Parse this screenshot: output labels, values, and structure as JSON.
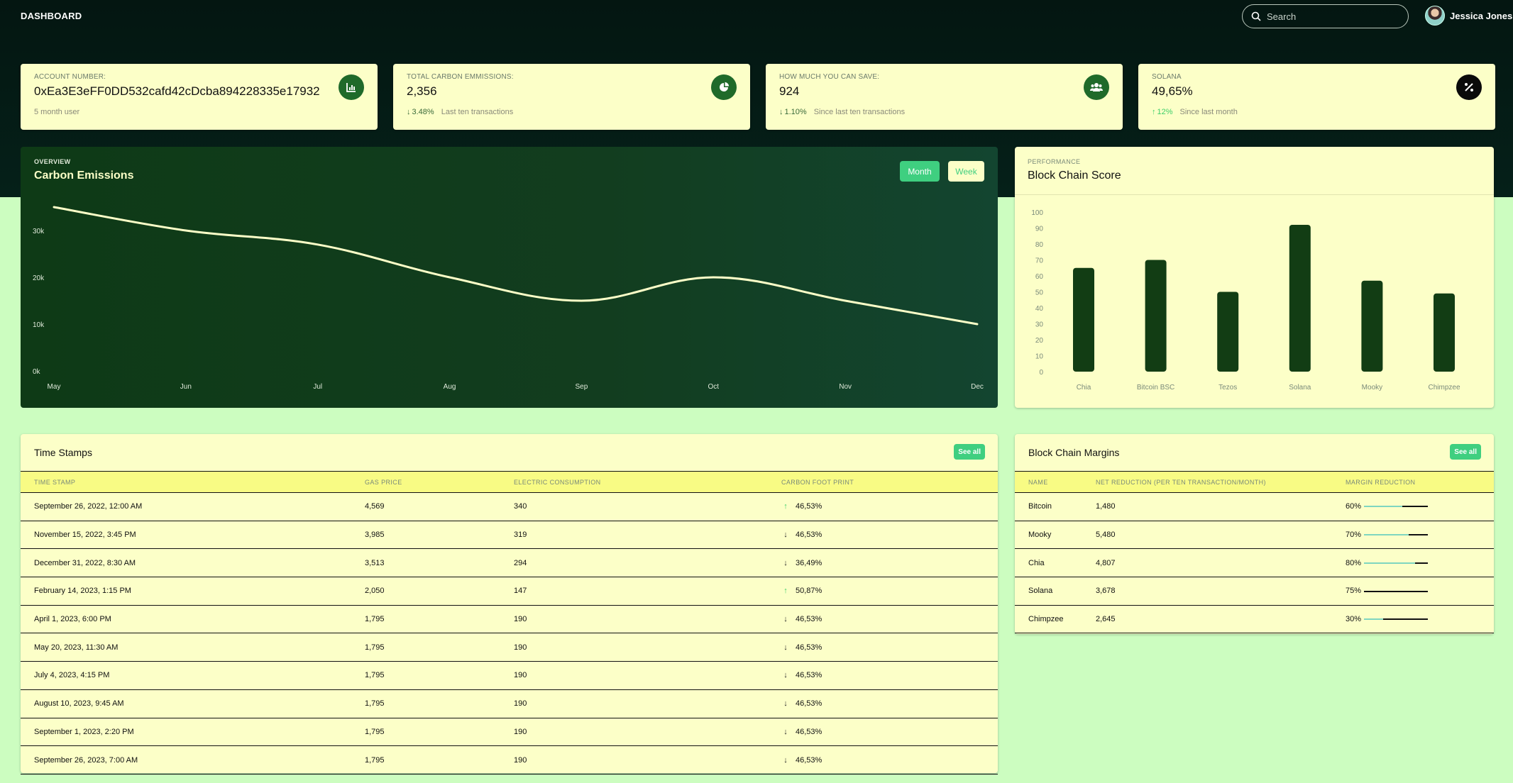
{
  "header": {
    "brand": "DASHBOARD",
    "search_placeholder": "Search",
    "user_name": "Jessica Jones"
  },
  "stats": [
    {
      "label": "ACCOUNT NUMBER:",
      "value": "0xEa3E3eFF0DD532cafd42cDcba894228335e17932",
      "change": "",
      "direction": "",
      "foot": "5 month user",
      "icon": "bar-chart-icon"
    },
    {
      "label": "TOTAL CARBON EMMISSIONS:",
      "value": "2,356",
      "change": "3.48%",
      "direction": "down",
      "foot": "Last ten transactions",
      "icon": "pie-chart-icon"
    },
    {
      "label": "HOW MUCH YOU CAN SAVE:",
      "value": "924",
      "change": "1.10%",
      "direction": "down",
      "foot": "Since last ten transactions",
      "icon": "users-icon"
    },
    {
      "label": "SOLANA",
      "value": "49,65%",
      "change": "12%",
      "direction": "up",
      "foot": "Since last month",
      "icon": "percent-icon"
    }
  ],
  "overview": {
    "kicker": "OVERVIEW",
    "title": "Carbon Emissions",
    "btn_month": "Month",
    "btn_week": "Week"
  },
  "performance": {
    "kicker": "PERFORMANCE",
    "title": "Block Chain Score"
  },
  "chart_data": [
    {
      "type": "line",
      "title": "Carbon Emissions",
      "x": [
        "May",
        "Jun",
        "Jul",
        "Aug",
        "Sep",
        "Oct",
        "Nov",
        "Dec"
      ],
      "values": [
        35000,
        30000,
        27000,
        20000,
        15000,
        20000,
        15000,
        10000
      ],
      "y_ticks": [
        "0k",
        "10k",
        "20k",
        "30k"
      ],
      "ylim": [
        0,
        40000
      ],
      "color": "#fcffc8",
      "grid": false,
      "smooth": true
    },
    {
      "type": "bar",
      "title": "Block Chain Score",
      "categories": [
        "Chia",
        "Bitcoin BSC",
        "Tezos",
        "Solana",
        "Mooky",
        "Chimpzee"
      ],
      "values": [
        65,
        70,
        50,
        92,
        57,
        49
      ],
      "y_ticks": [
        0,
        10,
        20,
        30,
        40,
        50,
        60,
        70,
        80,
        90,
        100
      ],
      "ylim": [
        0,
        100
      ],
      "color": "#123d14",
      "grid": false
    }
  ],
  "timestamps": {
    "title": "Time Stamps",
    "see_all": "See all",
    "columns": [
      "TIME STAMP",
      "GAS PRICE",
      "ELECTRIC CONSUMPTION",
      "CARBON FOOT PRINT"
    ],
    "rows": [
      {
        "time": "September 26, 2022, 12:00 AM",
        "gas": "4,569",
        "electric": "340",
        "dir": "up",
        "carbon": "46,53%"
      },
      {
        "time": "November 15, 2022, 3:45 PM",
        "gas": "3,985",
        "electric": "319",
        "dir": "down",
        "carbon": "46,53%"
      },
      {
        "time": "December 31, 2022, 8:30 AM",
        "gas": "3,513",
        "electric": "294",
        "dir": "down",
        "carbon": "36,49%"
      },
      {
        "time": "February 14, 2023, 1:15 PM",
        "gas": "2,050",
        "electric": "147",
        "dir": "up",
        "carbon": "50,87%"
      },
      {
        "time": "April 1, 2023, 6:00 PM",
        "gas": "1,795",
        "electric": "190",
        "dir": "down",
        "carbon": "46,53%"
      },
      {
        "time": "May 20, 2023, 11:30 AM",
        "gas": "1,795",
        "electric": "190",
        "dir": "down",
        "carbon": "46,53%"
      },
      {
        "time": "July 4, 2023, 4:15 PM",
        "gas": "1,795",
        "electric": "190",
        "dir": "down",
        "carbon": "46,53%"
      },
      {
        "time": "August 10, 2023, 9:45 AM",
        "gas": "1,795",
        "electric": "190",
        "dir": "down",
        "carbon": "46,53%"
      },
      {
        "time": "September 1, 2023, 2:20 PM",
        "gas": "1,795",
        "electric": "190",
        "dir": "down",
        "carbon": "46,53%"
      },
      {
        "time": "September 26, 2023, 7:00 AM",
        "gas": "1,795",
        "electric": "190",
        "dir": "down",
        "carbon": "46,53%"
      }
    ]
  },
  "margins": {
    "title": "Block Chain Margins",
    "see_all": "See all",
    "columns": [
      "NAME",
      "NET REDUCTION (PER TEN TRANSACTION/MONTH)",
      "MARGIN REDUCTION"
    ],
    "rows": [
      {
        "name": "Bitcoin",
        "net": "1,480",
        "pct": "60%",
        "fill": 0.6
      },
      {
        "name": "Mooky",
        "net": "5,480",
        "pct": "70%",
        "fill": 0.7
      },
      {
        "name": "Chia",
        "net": "4,807",
        "pct": "80%",
        "fill": 0.8
      },
      {
        "name": "Solana",
        "net": "3,678",
        "pct": "75%",
        "fill": 0.0
      },
      {
        "name": "Chimpzee",
        "net": "2,645",
        "pct": "30%",
        "fill": 0.3
      }
    ]
  }
}
